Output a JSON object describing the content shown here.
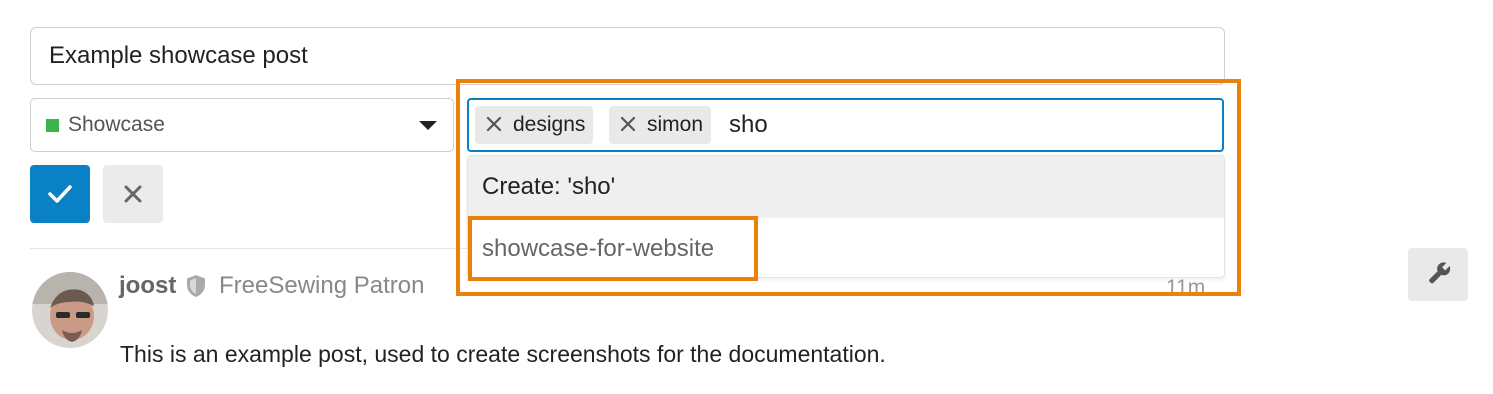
{
  "composer": {
    "title_value": "Example showcase post",
    "category": {
      "label": "Showcase",
      "color": "#3ab54a"
    },
    "tags": {
      "selected": [
        "designs",
        "simon"
      ],
      "filter_value": "sho"
    },
    "dropdown": {
      "create_label": "Create: 'sho'",
      "suggestion": "showcase-for-website"
    },
    "save_icon": "check-icon",
    "cancel_icon": "close-icon"
  },
  "post": {
    "username": "joost",
    "user_title": "FreeSewing Patron",
    "time": "11m",
    "body": "This is an example post, used to create screenshots for the documentation."
  },
  "admin": {
    "icon": "wrench-icon"
  },
  "colors": {
    "accent": "#0a81c5",
    "highlight": "#e8820c",
    "category": "#3ab54a"
  }
}
